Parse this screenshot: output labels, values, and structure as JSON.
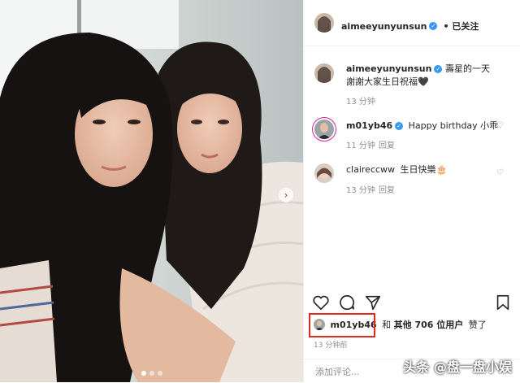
{
  "post": {
    "author": "aimeeyunyunsun",
    "follow_status": "• 已关注",
    "caption": "壽星的一天\n謝謝大家生日祝福🖤",
    "caption_time": "13 分钟"
  },
  "comments": [
    {
      "user": "m01yb46",
      "text": "Happy birthday 小乖",
      "time": "11 分钟",
      "reply": "回复"
    },
    {
      "user": "claireccww",
      "text": "生日快樂🎂",
      "time": "13 分钟",
      "reply": "回复"
    }
  ],
  "likes": {
    "user": "m01yb46",
    "mid": "和",
    "others": "其他 706 位用户",
    "suffix": "赞了"
  },
  "timestamp": "13 分钟前",
  "add_comment": {
    "placeholder": "添加评论..."
  },
  "watermark": "头条 @盘一盘小娱",
  "colors": {
    "verified": "#3897f0",
    "highlight": "#e0281c",
    "meta": "#8e8e8e"
  }
}
